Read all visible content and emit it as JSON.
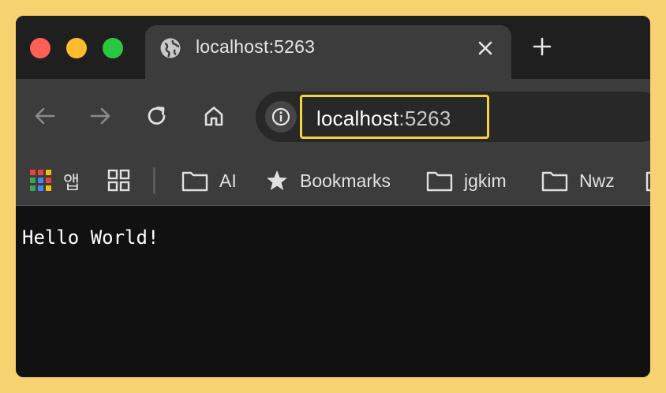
{
  "tab": {
    "title": "localhost:5263",
    "icon": "globe-icon"
  },
  "toolbar": {
    "url_host": "localhost",
    "url_port": ":5263"
  },
  "bookmarks": {
    "apps_label": "앱",
    "items": [
      {
        "label": "AI",
        "icon": "folder-icon"
      },
      {
        "label": "Bookmarks",
        "icon": "star-icon"
      },
      {
        "label": "jgkim",
        "icon": "folder-icon"
      },
      {
        "label": "Nwz",
        "icon": "folder-icon"
      }
    ]
  },
  "page": {
    "text": "Hello World!"
  },
  "colors": {
    "frame": "#f6d271",
    "highlight": "#f7d23e",
    "tab_bg": "#3c3c3c",
    "content_bg": "#111111"
  }
}
